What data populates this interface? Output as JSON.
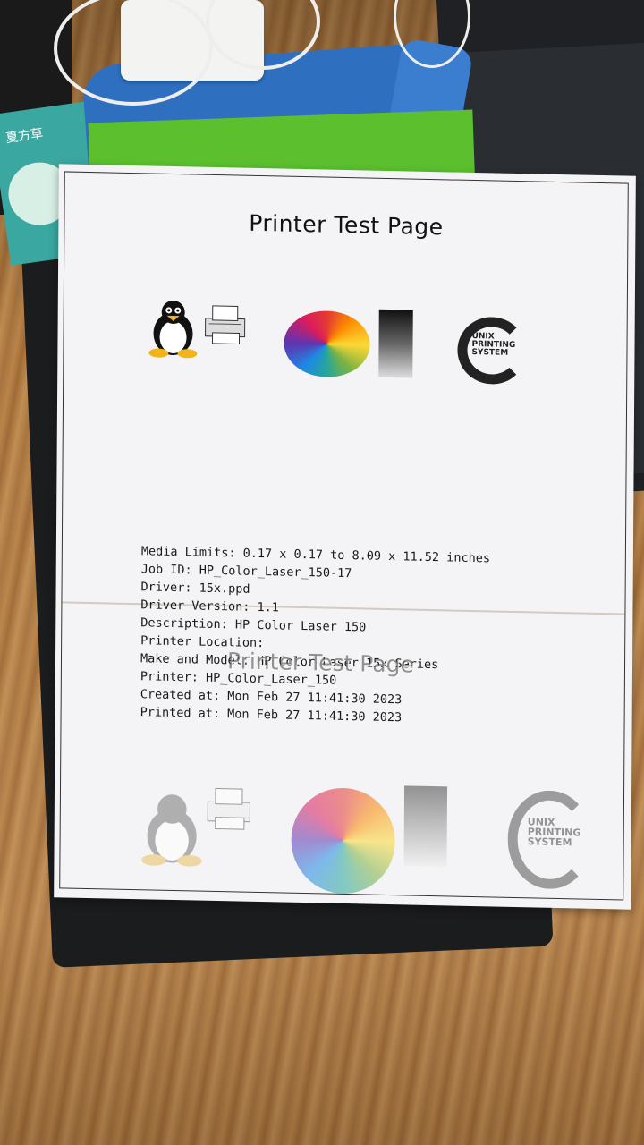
{
  "scene": {
    "box_label": "夏方草"
  },
  "test_page": {
    "title": "Printer Test Page",
    "logo_text": [
      "UNIX",
      "PRINTING",
      "SYSTEM"
    ],
    "info_lines": [
      "Media Limits: 0.17 x 0.17 to 8.09 x 11.52 inches",
      "Job ID: HP_Color_Laser_150-17",
      "Driver: 15x.ppd",
      "Driver Version: 1.1",
      "Description: HP Color Laser 150",
      "Printer Location:",
      "Make and Model: HP Color Laser 15x Series",
      "Printer: HP_Color_Laser_150",
      "Created at: Mon Feb 27 11:41:30 2023",
      "Printed at: Mon Feb 27 11:41:30 2023"
    ]
  },
  "icons": {
    "penguin": "tux-penguin-icon",
    "printer": "printer-icon",
    "color_wheel": "color-wheel-icon",
    "gray_ramp": "grayscale-ramp-icon",
    "cups": "cups-logo-icon"
  }
}
